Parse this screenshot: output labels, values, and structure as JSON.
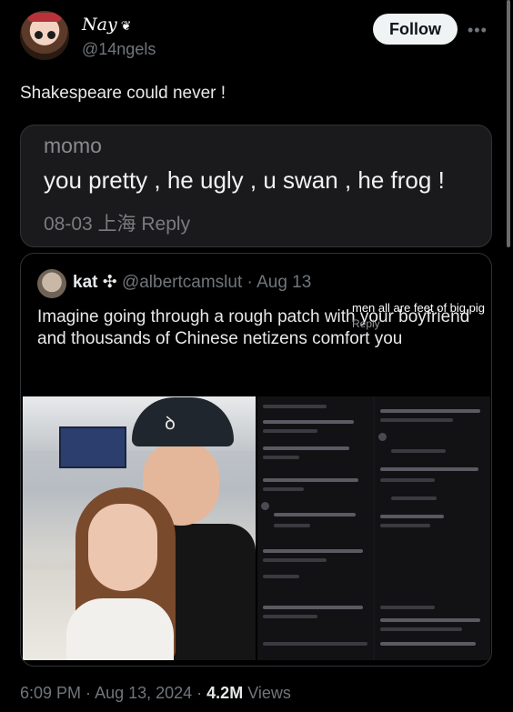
{
  "author": {
    "display_name": "Nay",
    "name_mark": "❦",
    "handle": "@14ngels",
    "follow_label": "Follow",
    "more_label": "•••"
  },
  "tweet": {
    "text": "Shakespeare could never !"
  },
  "screenshot_comment": {
    "user": "momo",
    "comment": "you pretty , he ugly , u swan , he frog !",
    "meta": "08-03 上海 Reply"
  },
  "quoted": {
    "name": "kat",
    "name_mark": "✣",
    "handle": "@albertcamslut",
    "sep": "·",
    "date": "Aug 13",
    "text": "Imagine going through a rough patch with your boyfriend and thousands of Chinese netizens comfort you",
    "cap_logo": "ꝺ",
    "overlay_comment": "men all are feet of big pig",
    "overlay_reply": "Reply"
  },
  "footer": {
    "time": "6:09 PM",
    "sep1": " · ",
    "date": "Aug 13, 2024",
    "sep2": " · ",
    "views_count": "4.2M",
    "views_label": " Views"
  }
}
